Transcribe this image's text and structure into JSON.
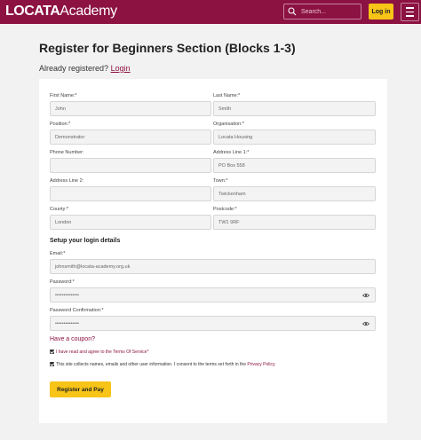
{
  "header": {
    "logo_bold": "LOCATA",
    "logo_light": "Academy",
    "search_placeholder": "Search...",
    "login_label": "Log in"
  },
  "page": {
    "title": "Register for Beginners Section (Blocks 1-3)",
    "already_text": "Already registered?",
    "login_link": "Login"
  },
  "form": {
    "first_name": {
      "label": "First Name:*",
      "value": "John"
    },
    "last_name": {
      "label": "Last Name:*",
      "value": "Smith"
    },
    "position": {
      "label": "Position:*",
      "value": "Demonstrator"
    },
    "organisation": {
      "label": "Organisation:*",
      "value": "Locata Housing"
    },
    "phone": {
      "label": "Phone Number:",
      "value": ""
    },
    "address1": {
      "label": "Address Line 1:*",
      "value": "PO Box 558"
    },
    "address2": {
      "label": "Address Line 2:",
      "value": ""
    },
    "town": {
      "label": "Town:*",
      "value": "Twickenham"
    },
    "county": {
      "label": "County:*",
      "value": "London"
    },
    "postcode": {
      "label": "Postcode:*",
      "value": "TW1 9RF"
    },
    "login_section": "Setup your login details",
    "email": {
      "label": "Email:*",
      "value": "johnsmith@locata-academy.org.uk"
    },
    "password": {
      "label": "Password:*",
      "value": "••••••••••••••"
    },
    "password_confirm": {
      "label": "Password Confirmation:*",
      "value": "••••••••••••••"
    },
    "coupon": "Have a coupon?",
    "terms_text": "I have read and agree to the Terms Of Service*",
    "consent_text": "This site collects names, emails and other user information. I consent to the terms set forth in the",
    "privacy_link": "Privacy Policy.",
    "submit_label": "Register and Pay"
  },
  "colors": {
    "brand": "#8c1242",
    "accent": "#f7c417"
  }
}
